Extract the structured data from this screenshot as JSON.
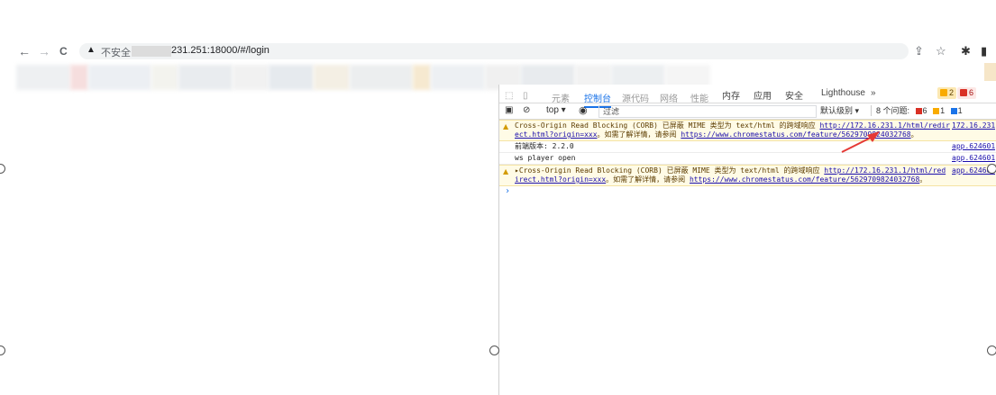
{
  "browser": {
    "back_glyph": "←",
    "forward_glyph": "→",
    "reload_glyph": "C",
    "security_label": "不安全",
    "url_visible": "231.251:18000/#/login",
    "icons": [
      "back-icon",
      "forward-icon",
      "reload-icon",
      "insecure-warning-icon",
      "share-icon",
      "bookmark-star-icon",
      "extensions-puzzle-icon",
      "side-panel-icon"
    ]
  },
  "devtools": {
    "tabs": [
      "元素",
      "控制台",
      "源代码",
      "网络",
      "性能",
      "内存",
      "应用",
      "安全",
      "Lighthouse",
      "»"
    ],
    "active_tab": "控制台",
    "warn_count": "2",
    "error_count": "6",
    "toolbar": {
      "context": "top",
      "filter_placeholder": "过滤",
      "level": "默认级别",
      "issues_label": "8 个问题:",
      "issue_err": "6",
      "issue_warn": "1",
      "issue_info": "1"
    },
    "console": [
      {
        "type": "warning",
        "line1_prefix": "Cross-Origin Read Blocking (CORB) 已屏蔽 MIME 类型为 text/html 的跨域响应 ",
        "line1_link": "http://172.16.231.1/html/redir",
        "line2_link": "ect.html?origin=xxx",
        "line2_mid": "。如需了解详情，请参阅 ",
        "line2_link2": "https://www.chromestatus.com/feature/5629709824032768",
        "line2_end": "。",
        "source": "172.16.231"
      },
      {
        "type": "log",
        "text": "前端版本: 2.2.0",
        "source": "app.624601"
      },
      {
        "type": "log",
        "text": "ws player open",
        "source": "app.624601"
      },
      {
        "type": "warning",
        "line1_prefix": "▸Cross-Origin Read Blocking (CORB) 已屏蔽 MIME 类型为 text/html 的跨域响应 ",
        "line1_link": "http://172.16.231.1/html/red",
        "line2_link": "irect.html?origin=xxx",
        "line2_mid": "。如需了解详情，请参阅 ",
        "line2_link2": "https://www.chromestatus.com/feature/5629709824032768",
        "line2_end": "。",
        "source": "app.624601"
      }
    ],
    "prompt": "›"
  },
  "colors": {
    "accent": "#1a73e8",
    "arrow": "#e53935",
    "warning_bg": "#fffbe6",
    "link": "#1a0dab"
  }
}
